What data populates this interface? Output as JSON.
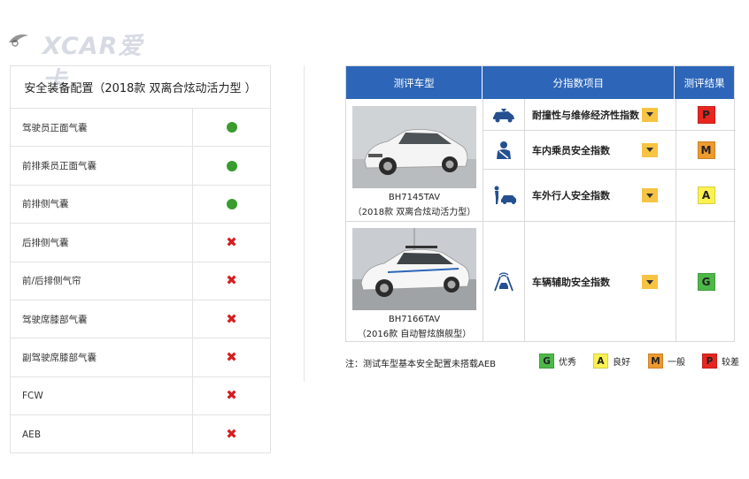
{
  "watermark": {
    "text": "XCAR爱卡"
  },
  "left": {
    "title": "安全装备配置（2018款 双离合炫动活力型 ）",
    "rows": [
      {
        "label": "驾驶员正面气囊",
        "value": "yes"
      },
      {
        "label": "前排乘员正面气囊",
        "value": "yes"
      },
      {
        "label": "前排侧气囊",
        "value": "yes"
      },
      {
        "label": "后排侧气囊",
        "value": "no"
      },
      {
        "label": "前/后排侧气帘",
        "value": "no"
      },
      {
        "label": "驾驶席膝部气囊",
        "value": "no"
      },
      {
        "label": "副驾驶席膝部气囊",
        "value": "no"
      },
      {
        "label": "FCW",
        "value": "no"
      },
      {
        "label": "AEB",
        "value": "no"
      }
    ],
    "yes_color": "#3a9b2e",
    "no_color": "#d51f1f"
  },
  "right": {
    "headers": {
      "model": "测评车型",
      "index": "分指数项目",
      "result": "测评结果"
    },
    "vehicles": [
      {
        "code": "BH7145TAV",
        "desc": "（2018款 双离合炫动活力型）"
      },
      {
        "code": "BH7166TAV",
        "desc": "（2016款 自动智炫旗舰型）"
      }
    ],
    "indices": [
      {
        "name": "耐撞性与维修经济性指数",
        "icon": "car-repair-icon",
        "result": "P",
        "color": "#e8261f"
      },
      {
        "name": "车内乘员安全指数",
        "icon": "occupant-icon",
        "result": "M",
        "color": "#ef9a2e"
      },
      {
        "name": "车外行人安全指数",
        "icon": "pedestrian-icon",
        "result": "A",
        "color": "#fbf250"
      },
      {
        "name": "车辆辅助安全指数",
        "icon": "assist-icon",
        "result": "G",
        "color": "#4cb848"
      }
    ],
    "header_color": "#2d66b9"
  },
  "footnote": "注：测试车型基本安全配置未搭载AEB",
  "legend": [
    {
      "letter": "G",
      "label": "优秀",
      "color": "#4cb848"
    },
    {
      "letter": "A",
      "label": "良好",
      "color": "#fbf250"
    },
    {
      "letter": "M",
      "label": "一般",
      "color": "#ef9a2e"
    },
    {
      "letter": "P",
      "label": "较差",
      "color": "#e8261f"
    }
  ]
}
